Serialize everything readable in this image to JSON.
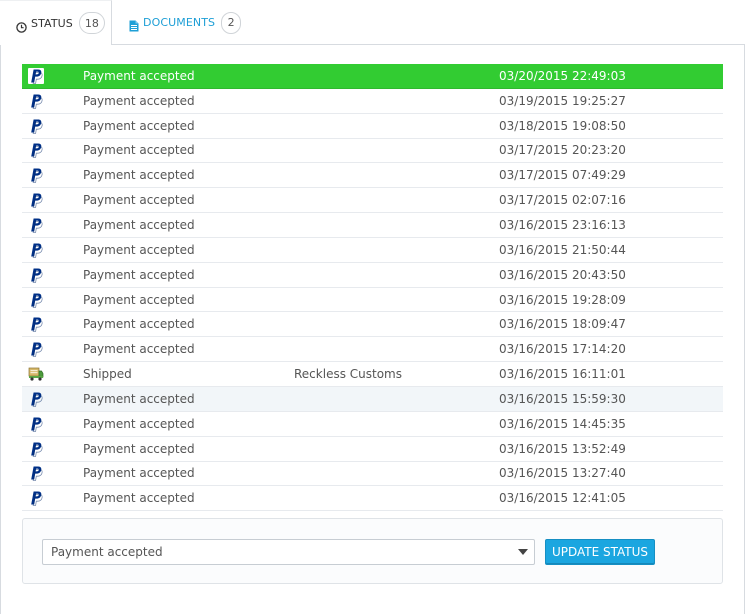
{
  "tabs": [
    {
      "label": "STATUS",
      "count": "18",
      "icon": "clock-icon"
    },
    {
      "label": "DOCUMENTS",
      "count": "2",
      "icon": "document-icon"
    }
  ],
  "history": [
    {
      "icon": "paypal-icon",
      "status": "Payment accepted",
      "employee": "",
      "date": "03/20/2015 22:49:03"
    },
    {
      "icon": "paypal-icon",
      "status": "Payment accepted",
      "employee": "",
      "date": "03/19/2015 19:25:27"
    },
    {
      "icon": "paypal-icon",
      "status": "Payment accepted",
      "employee": "",
      "date": "03/18/2015 19:08:50"
    },
    {
      "icon": "paypal-icon",
      "status": "Payment accepted",
      "employee": "",
      "date": "03/17/2015 20:23:20"
    },
    {
      "icon": "paypal-icon",
      "status": "Payment accepted",
      "employee": "",
      "date": "03/17/2015 07:49:29"
    },
    {
      "icon": "paypal-icon",
      "status": "Payment accepted",
      "employee": "",
      "date": "03/17/2015 02:07:16"
    },
    {
      "icon": "paypal-icon",
      "status": "Payment accepted",
      "employee": "",
      "date": "03/16/2015 23:16:13"
    },
    {
      "icon": "paypal-icon",
      "status": "Payment accepted",
      "employee": "",
      "date": "03/16/2015 21:50:44"
    },
    {
      "icon": "paypal-icon",
      "status": "Payment accepted",
      "employee": "",
      "date": "03/16/2015 20:43:50"
    },
    {
      "icon": "paypal-icon",
      "status": "Payment accepted",
      "employee": "",
      "date": "03/16/2015 19:28:09"
    },
    {
      "icon": "paypal-icon",
      "status": "Payment accepted",
      "employee": "",
      "date": "03/16/2015 18:09:47"
    },
    {
      "icon": "paypal-icon",
      "status": "Payment accepted",
      "employee": "",
      "date": "03/16/2015 17:14:20"
    },
    {
      "icon": "shipping-truck-icon",
      "status": "Shipped",
      "employee": "Reckless Customs",
      "date": "03/16/2015 16:11:01"
    },
    {
      "icon": "paypal-icon",
      "status": "Payment accepted",
      "employee": "",
      "date": "03/16/2015 15:59:30"
    },
    {
      "icon": "paypal-icon",
      "status": "Payment accepted",
      "employee": "",
      "date": "03/16/2015 14:45:35"
    },
    {
      "icon": "paypal-icon",
      "status": "Payment accepted",
      "employee": "",
      "date": "03/16/2015 13:52:49"
    },
    {
      "icon": "paypal-icon",
      "status": "Payment accepted",
      "employee": "",
      "date": "03/16/2015 13:27:40"
    },
    {
      "icon": "paypal-icon",
      "status": "Payment accepted",
      "employee": "",
      "date": "03/16/2015 12:41:05"
    }
  ],
  "form": {
    "selected_status": "Payment accepted",
    "update_button": "UPDATE STATUS"
  },
  "colors": {
    "current_status": "#32cc32",
    "accent": "#1ba6e0",
    "paypal_dark": "#003087"
  }
}
